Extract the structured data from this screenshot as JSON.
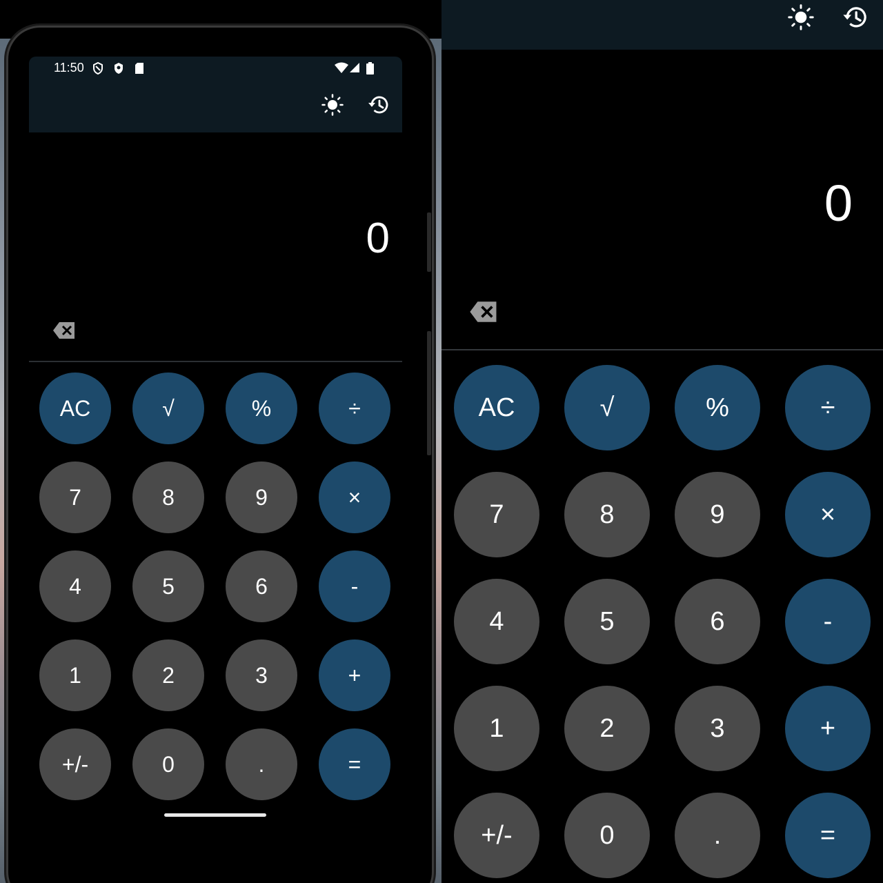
{
  "status_bar": {
    "time": "11:50"
  },
  "display": {
    "value": "0"
  },
  "keys": {
    "ac": "AC",
    "sqrt": "√",
    "percent": "%",
    "divide": "÷",
    "seven": "7",
    "eight": "8",
    "nine": "9",
    "multiply": "×",
    "four": "4",
    "five": "5",
    "six": "6",
    "minus": "-",
    "one": "1",
    "two": "2",
    "three": "3",
    "plus": "+",
    "plusminus": "+/-",
    "zero": "0",
    "dot": ".",
    "equals": "="
  },
  "icons": {
    "theme": "sun-icon",
    "history": "history-icon",
    "backspace": "backspace-icon",
    "status": [
      "vpn-shield-icon",
      "shield-icon",
      "sd-card-icon",
      "wifi-icon",
      "signal-icon",
      "battery-icon"
    ]
  },
  "colors": {
    "background": "#000000",
    "toolbar": "#0d1a22",
    "number_key": "#4a4a4a",
    "operator_key": "#1d4a6b",
    "text": "#ffffff"
  }
}
